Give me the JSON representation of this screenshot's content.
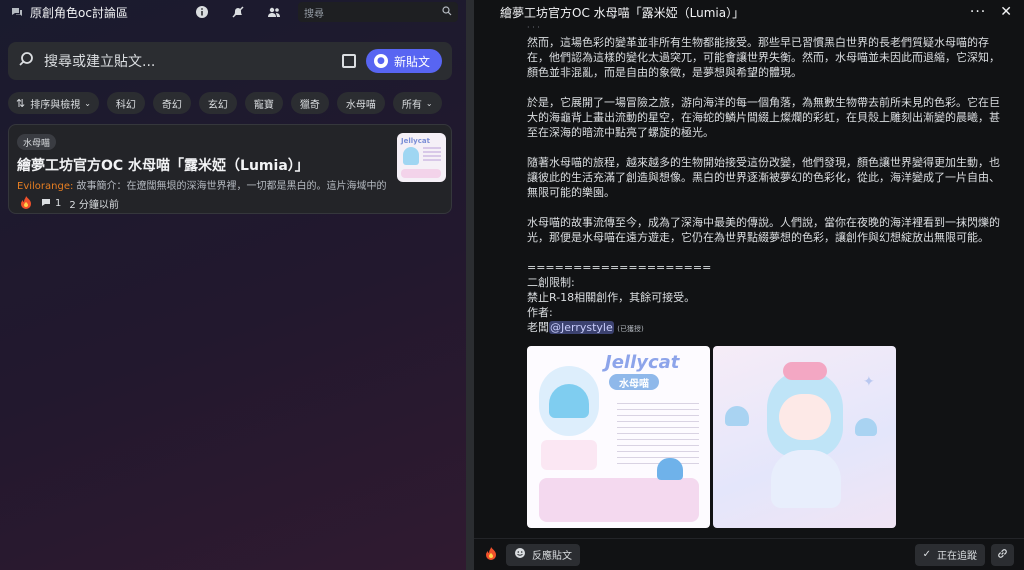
{
  "left": {
    "channel_title": "原創角色oc討論區",
    "search_placeholder": "搜尋",
    "post_search_placeholder": "搜尋或建立貼文...",
    "new_post_label": "新貼文",
    "sort_label": "排序與檢視",
    "tags": [
      "科幻",
      "奇幻",
      "玄幻",
      "寵寶",
      "獵奇",
      "水母喵"
    ],
    "all_label": "所有",
    "post": {
      "tag": "水母喵",
      "title": "繪夢工坊官方OC 水母喵「露米婭（Lumia）」",
      "author": "Evilorange:",
      "excerpt": " 故事簡介：在遼闊無垠的深海世界裡，一切都是黑白的。這片海域中的生物...",
      "comments": "1",
      "time": "2 分鐘以前",
      "thumb_title": "Jellycat"
    }
  },
  "right": {
    "thread_title": "繪夢工坊官方OC 水母喵「露米婭（Lumia）」",
    "paragraphs": [
      "然而，這場色彩的變革並非所有生物都能接受。那些早已習慣黑白世界的長老們質疑水母喵的存在，他們認為這樣的變化太過突兀，可能會讓世界失衡。然而，水母喵並未因此而退縮，它深知，顏色並非混亂，而是自由的象徵，是夢想與希望的體現。",
      "於是，它展開了一場冒險之旅，游向海洋的每一個角落，為無數生物帶去前所未見的色彩。它在巨大的海龜背上畫出流動的星空，在海蛇的鱗片間綴上燦爛的彩虹，在貝殼上雕刻出漸變的晨曦，甚至在深海的暗流中點亮了螺旋的極光。",
      "隨著水母喵的旅程，越來越多的生物開始接受這份改變，他們發現，顏色讓世界變得更加生動，也讓彼此的生活充滿了創造與想像。黑白的世界逐漸被夢幻的色彩化，從此，海洋變成了一片自由、無限可能的樂園。",
      "水母喵的故事流傳至今，成為了深海中最美的傳說。人們說，當你在夜晚的海洋裡看到一抹閃爍的光，那便是水母喵在遠方遊走，它仍在為世界點綴夢想的色彩，讓創作與幻想綻放出無限可能。"
    ],
    "separator": "====================",
    "restriction_label": "二創限制:",
    "restriction": "禁止R-18相關創作，其餘可接受。",
    "author_label": "作者:",
    "author_prefix": "老闆",
    "author_mention": "@Jerrystyle",
    "author_note": "(已獲授)",
    "img1_title": "Jellycat",
    "img1_subtitle": "水母喵",
    "reply_label": "反應貼文",
    "following_label": "正在追蹤"
  },
  "colors": {
    "accent": "#5865f2",
    "author": "#e67e22"
  }
}
